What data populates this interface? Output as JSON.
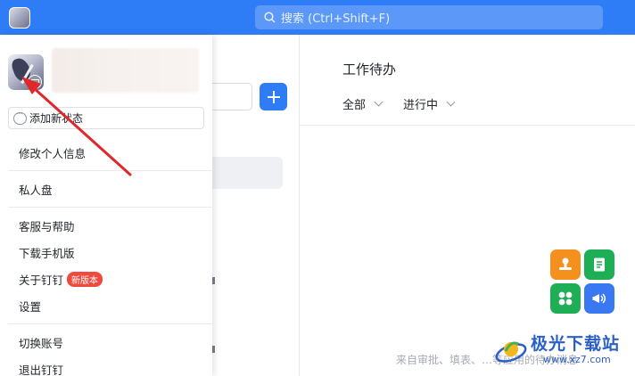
{
  "topbar": {
    "search_placeholder": "搜索 (Ctrl+Shift+F)",
    "accent_color": "#2e7cf6"
  },
  "main": {
    "title": "工作待办",
    "filters": [
      {
        "label": "全部"
      },
      {
        "label": "进行中"
      }
    ],
    "empty_text": "来自审批、填表、…等应用的待办消息"
  },
  "quick_apps": [
    {
      "icon": "stamp-icon",
      "color": "#f5901e"
    },
    {
      "icon": "document-icon",
      "color": "#1dae56"
    },
    {
      "icon": "grid-apps-icon",
      "color": "#1dae56"
    },
    {
      "icon": "megaphone-icon",
      "color": "#3a78f2"
    }
  ],
  "profile_menu": {
    "status_button": "添加新状态",
    "items": {
      "edit_profile": "修改个人信息",
      "private_disk": "私人盘",
      "help": "客服与帮助",
      "download_mobile": "下载手机版",
      "about": "关于钉钉",
      "about_badge": "新版本",
      "settings": "设置",
      "switch_account": "切换账号",
      "logout": "退出钉钉"
    }
  },
  "watermark": {
    "title": "极光下载站",
    "url": "www.xz7.com"
  }
}
